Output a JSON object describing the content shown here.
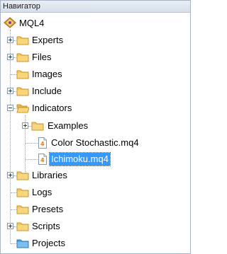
{
  "window": {
    "title": "Навигатор"
  },
  "tree": {
    "root": {
      "label": "MQL4",
      "icon": "mql4-diamond-icon"
    },
    "items": [
      {
        "label": "Experts",
        "icon": "folder-icon",
        "expander": "plus"
      },
      {
        "label": "Files",
        "icon": "folder-icon",
        "expander": "plus"
      },
      {
        "label": "Images",
        "icon": "folder-icon",
        "expander": "none"
      },
      {
        "label": "Include",
        "icon": "folder-icon",
        "expander": "plus"
      },
      {
        "label": "Indicators",
        "icon": "folder-open-icon",
        "expander": "minus"
      },
      {
        "label": "Examples",
        "icon": "folder-icon",
        "expander": "plus"
      },
      {
        "label": "Color Stochastic.mq4",
        "icon": "mq4-file-icon",
        "expander": "none"
      },
      {
        "label": "Ichimoku.mq4",
        "icon": "mq4-file-icon",
        "expander": "none",
        "selected": true
      },
      {
        "label": "Libraries",
        "icon": "folder-icon",
        "expander": "plus"
      },
      {
        "label": "Logs",
        "icon": "folder-icon",
        "expander": "none"
      },
      {
        "label": "Presets",
        "icon": "folder-icon",
        "expander": "none"
      },
      {
        "label": "Scripts",
        "icon": "folder-icon",
        "expander": "plus"
      },
      {
        "label": "Projects",
        "icon": "folder-projects-icon",
        "expander": "none"
      }
    ]
  },
  "colors": {
    "selection": "#3399ff",
    "folder": "#f2c75c",
    "projects_folder": "#4aa3e8"
  }
}
